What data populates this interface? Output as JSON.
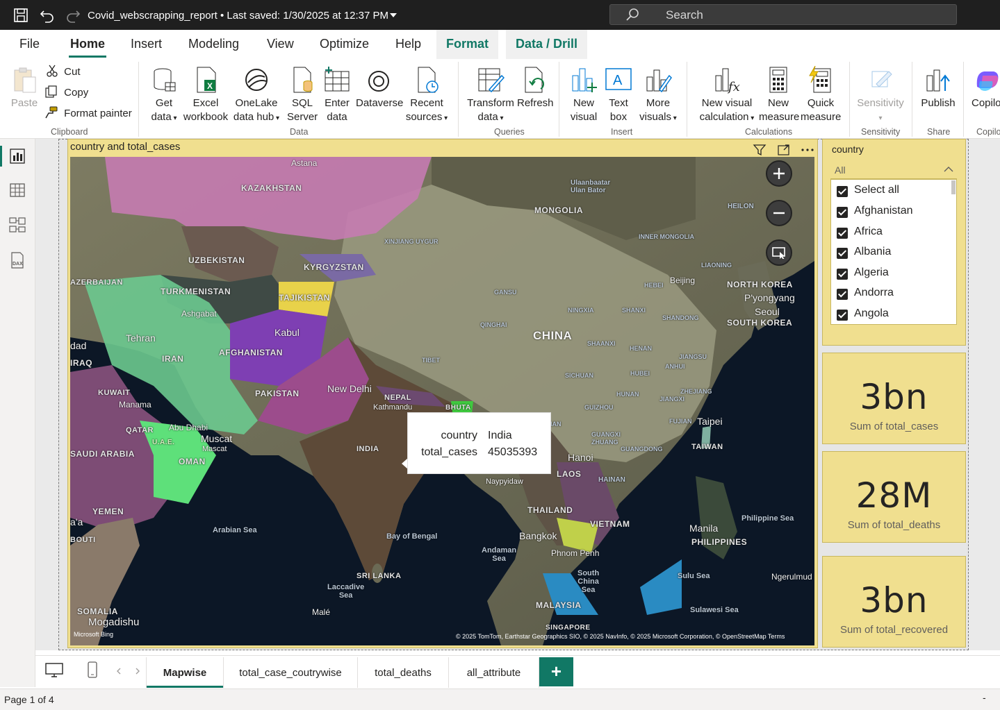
{
  "titlebar": {
    "doc_title": "Covid_webscrapping_report • Last saved: 1/30/2025 at 12:37 PM",
    "search_placeholder": "Search"
  },
  "menu": {
    "tabs": [
      "File",
      "Home",
      "Insert",
      "Modeling",
      "View",
      "Optimize",
      "Help"
    ],
    "active": "Home",
    "context_tabs": [
      "Format",
      "Data / Drill"
    ]
  },
  "ribbon": {
    "clipboard": {
      "paste": "Paste",
      "cut": "Cut",
      "copy": "Copy",
      "format_painter": "Format painter",
      "label": "Clipboard"
    },
    "data": {
      "get_data": [
        "Get",
        "data"
      ],
      "excel": [
        "Excel",
        "workbook"
      ],
      "onelake": [
        "OneLake",
        "data hub"
      ],
      "sql": [
        "SQL",
        "Server"
      ],
      "enter": [
        "Enter",
        "data"
      ],
      "dataverse": "Dataverse",
      "recent": [
        "Recent",
        "sources"
      ],
      "label": "Data"
    },
    "queries": {
      "transform": [
        "Transform",
        "data"
      ],
      "refresh": "Refresh",
      "label": "Queries"
    },
    "insert": {
      "new_visual": [
        "New",
        "visual"
      ],
      "text_box": [
        "Text",
        "box"
      ],
      "more_visuals": [
        "More",
        "visuals"
      ],
      "label": "Insert"
    },
    "calculations": {
      "new_visual_calc": [
        "New visual",
        "calculation"
      ],
      "new_measure": [
        "New",
        "measure"
      ],
      "quick_measure": [
        "Quick",
        "measure"
      ],
      "label": "Calculations"
    },
    "sensitivity": {
      "button": "Sensitivity",
      "label": "Sensitivity"
    },
    "share": {
      "publish": "Publish",
      "label": "Share"
    },
    "copilot": {
      "button": "Copilo",
      "label": "Copilo"
    }
  },
  "map_visual": {
    "title": "country and total_cases",
    "tooltip": {
      "k1": "country",
      "v1": "India",
      "k2": "total_cases",
      "v2": "45035393"
    },
    "attribution": "© 2025 TomTom, Earthstar Geographics SIO, © 2025 NavInfo, © 2025 Microsoft Corporation, © OpenStreetMap  Terms",
    "bing": "Microsoft Bing",
    "labels": {
      "astana": "Astana",
      "kazakhstan": "KAZAKHSTAN",
      "mongolia": "MONGOLIA",
      "ulaanbaatar": "Ulaanbaatar\nUlan Bator",
      "uzbekistan": "UZBEKISTAN",
      "kyrgyzstan": "KYRGYZSTAN",
      "xinjiang": "XINJIANG UYGUR",
      "inner_mongolia": "INNER MONGOLIA",
      "azerbaijan": "AZERBAIJAN",
      "turkmenistan": "TURKMENISTAN",
      "tajikistan": "TAJIKISTAN",
      "ashgabat": "Ashgabat",
      "beijing": "Beijing",
      "north_korea": "NORTH KOREA",
      "pyongyang": "P'yongyang",
      "seoul": "Seoul",
      "south_korea": "SOUTH KOREA",
      "tehran": "Tehran",
      "iran": "IRAN",
      "kabul": "Kabul",
      "afghanistan": "AFGHANISTAN",
      "china": "CHINA",
      "iraq": "IRAQ",
      "baghdad": "dad",
      "kuwait": "KUWAIT",
      "pakistan": "PAKISTAN",
      "new_delhi": "New Delhi",
      "nepal": "NEPAL",
      "kathmandu": "Kathmandu",
      "bhutan": "BHUTA",
      "manama": "Manama",
      "qatar": "QATAR",
      "abu_dhabi": "Abu Dhabi",
      "uae": "U.A.E.",
      "muscat": "Muscat",
      "muscat2": "Mascat",
      "oman": "OMAN",
      "saudi": "SAUDI ARABIA",
      "india": "INDIA",
      "taipei": "Taipei",
      "taiwan": "TAIWAN",
      "hanoi": "Hanoi",
      "hainan": "HAINAN",
      "yemen": "YEMEN",
      "arabian_sea": "Arabian Sea",
      "bay_bengal": "Bay of Bengal",
      "thailand": "THAILAND",
      "vietnam": "VIETNAM",
      "bangkok": "Bangkok",
      "phnom_penh": "Phnom Penh",
      "laos": "LAOS",
      "naypyidaw": "Naypyidaw",
      "manila": "Manila",
      "philippines": "PHILIPPINES",
      "philippine_sea": "Philippine Sea",
      "andaman": "Andaman\nSea",
      "sri_lanka": "SRI LANKA",
      "laccadive": "Laccadive\nSea",
      "male": "Malé",
      "south_china_sea": "South\nChina\nSea",
      "sulu_sea": "Sulu Sea",
      "ngerulmud": "Ngerulmud",
      "somalia": "SOMALIA",
      "mogadishu": "Mogadishu",
      "djibouti": "BOUTI",
      "malaysia": "MALAYSIA",
      "sulawesi": "Sulawesi Sea",
      "singapore": "SINGAPORE",
      "heilong": "HEILON",
      "liaoning": "LIAONING",
      "gansu": "GANSU",
      "ningxia": "NINGXIA",
      "shanxi": "SHANXI",
      "shandong": "SHANDONG",
      "qinghai": "QINGHAI",
      "shaanxi": "SHAANXI",
      "henan": "HENAN",
      "jiangsu": "JIANGSU",
      "tibet": "TIBET",
      "sichuan": "SICHUAN",
      "hubei": "HUBEI",
      "anhui": "ANHUI",
      "zhejiang": "ZHEJIANG",
      "hunan": "HUNAN",
      "jiangxi": "JIANGXI",
      "fujian": "FUJIAN",
      "guizhou": "GUIZHOU",
      "guangxi": "GUANGXI\nZHUANG",
      "guangdong": "GUANGDONG",
      "yunnan": "YUNNAN",
      "hebei": "HEBEI",
      "ala": "a'a"
    }
  },
  "slicer": {
    "title": "country",
    "dropdown_value": "All",
    "items": [
      "Select all",
      "Afghanistan",
      "Africa",
      "Albania",
      "Algeria",
      "Andorra",
      "Angola"
    ]
  },
  "cards": [
    {
      "value": "3bn",
      "label": "Sum of total_cases"
    },
    {
      "value": "28M",
      "label": "Sum of total_deaths"
    },
    {
      "value": "3bn",
      "label": "Sum of total_recovered"
    }
  ],
  "pages": {
    "tabs": [
      "Mapwise",
      "total_case_coutrywise",
      "total_deaths",
      "all_attribute"
    ],
    "active": "Mapwise",
    "add_label": "+"
  },
  "status": {
    "page_count": "Page 1 of 4",
    "zoom_dash": "-"
  }
}
